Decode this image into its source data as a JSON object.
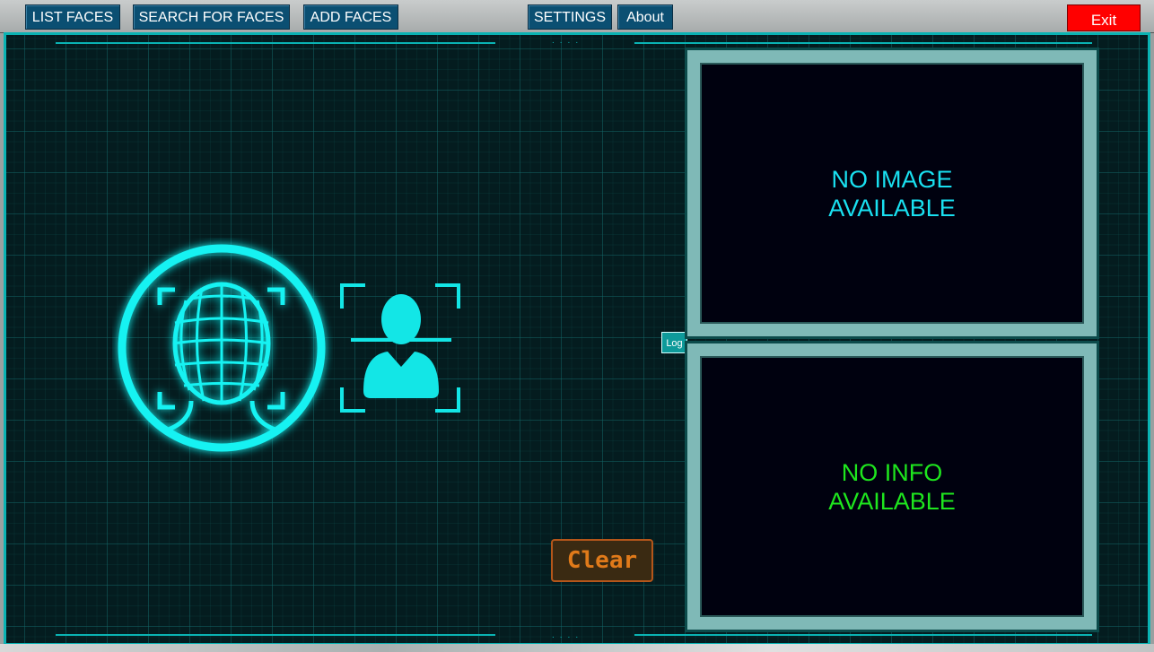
{
  "menu": {
    "list_faces": "LIST FACES",
    "search_for_faces": "SEARCH FOR FACES",
    "add_faces": "ADD FACES",
    "settings": "SETTINGS",
    "about": "About",
    "exit": "Exit"
  },
  "image_panel": {
    "line1": "NO IMAGE",
    "line2": "AVAILABLE"
  },
  "info_panel": {
    "line1": "NO INFO",
    "line2": "AVAILABLE"
  },
  "log_button": "Log",
  "clear_button": "Clear",
  "colors": {
    "accent": "#0ab3b3",
    "image_text": "#19e0f0",
    "info_text": "#1ee61e",
    "exit": "#ff0000",
    "clear": "#e07a1a"
  },
  "icons": [
    "face-scan-icon",
    "person-scan-icon"
  ]
}
